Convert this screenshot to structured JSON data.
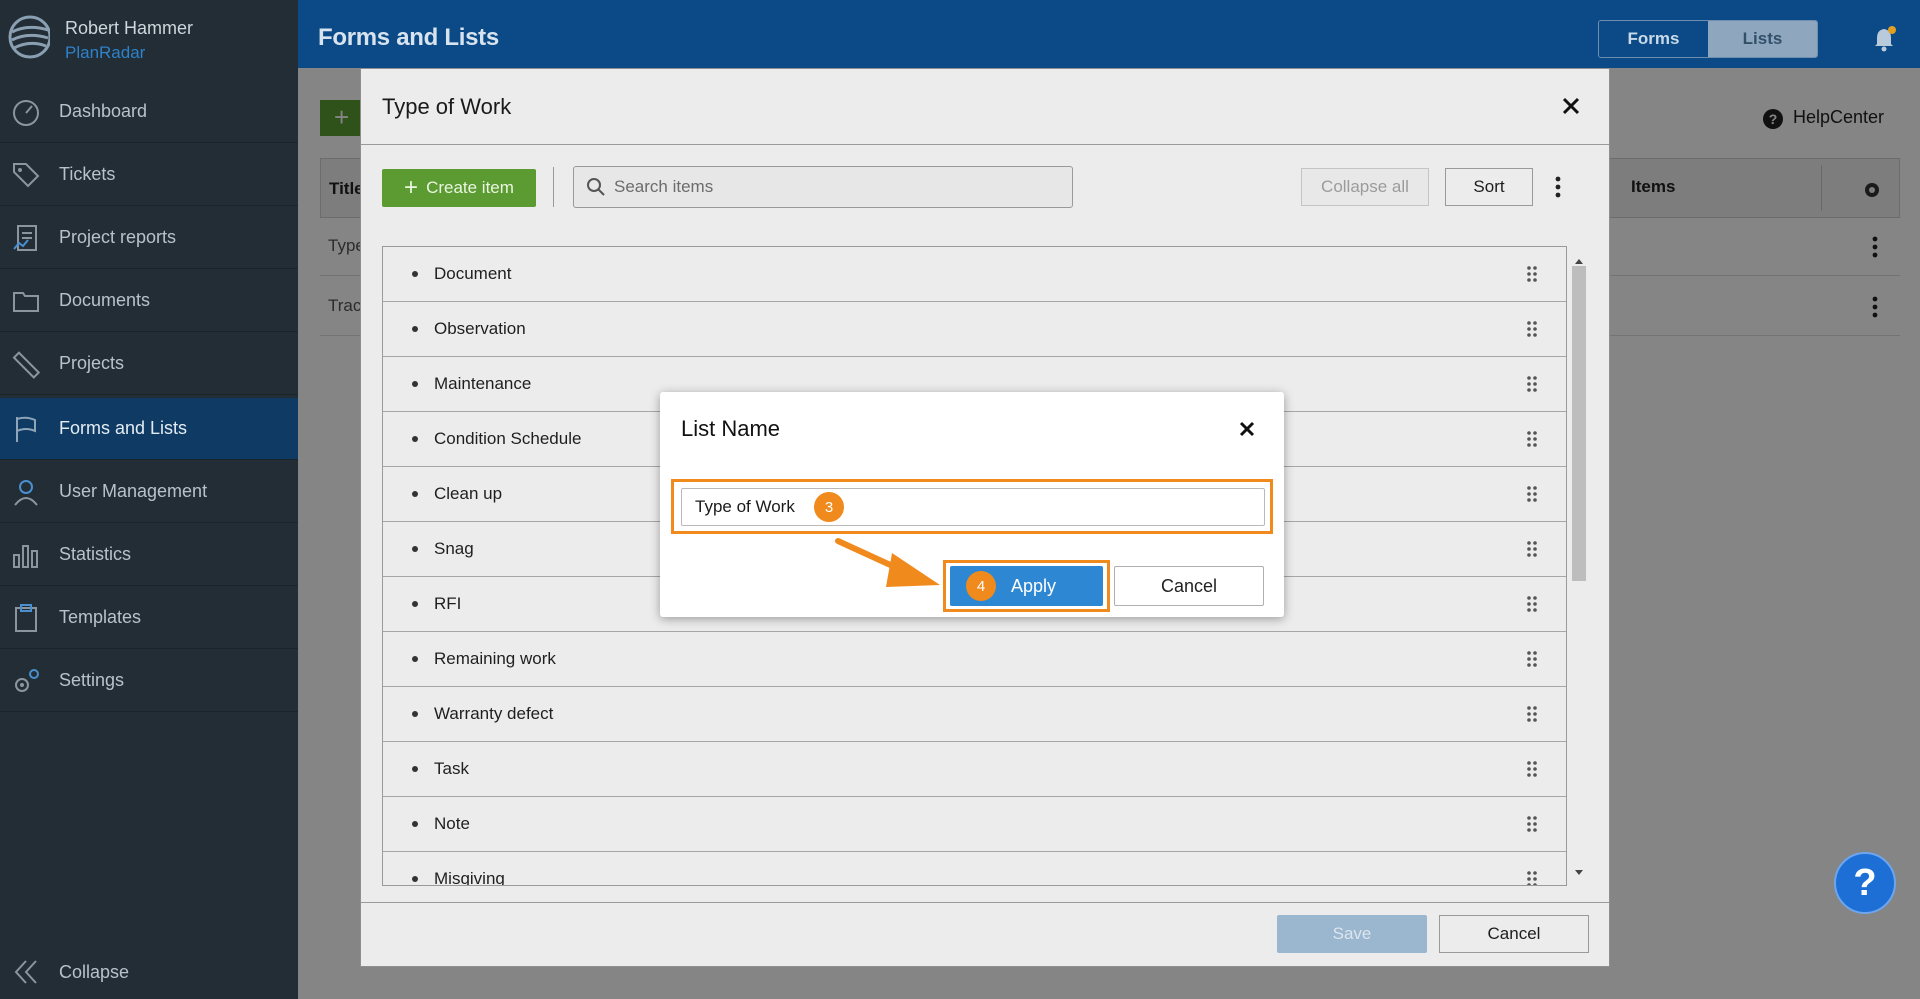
{
  "user": {
    "name": "Robert Hammer",
    "brand": "PlanRadar"
  },
  "sidebar": {
    "items": [
      {
        "label": "Dashboard",
        "icon": "gauge-icon"
      },
      {
        "label": "Tickets",
        "icon": "tag-icon"
      },
      {
        "label": "Project reports",
        "icon": "report-icon"
      },
      {
        "label": "Documents",
        "icon": "folder-icon"
      },
      {
        "label": "Projects",
        "icon": "ruler-icon"
      },
      {
        "label": "Forms and Lists",
        "icon": "flag-icon",
        "active": true
      },
      {
        "label": "User Management",
        "icon": "user-icon"
      },
      {
        "label": "Statistics",
        "icon": "bar-chart-icon"
      },
      {
        "label": "Templates",
        "icon": "clipboard-icon"
      },
      {
        "label": "Settings",
        "icon": "gear-icon"
      }
    ],
    "collapse_label": "Collapse"
  },
  "header": {
    "title": "Forms and Lists",
    "tabs": [
      {
        "label": "Forms",
        "active": true
      },
      {
        "label": "Lists",
        "active": false
      }
    ]
  },
  "background": {
    "helpcenter_label": "HelpCenter",
    "col_title": "Title",
    "col_items": "Items",
    "rows": [
      "Type",
      "Trac"
    ]
  },
  "modal": {
    "title": "Type of Work",
    "create_label": "Create item",
    "search_placeholder": "Search items",
    "collapse_all_label": "Collapse all",
    "sort_label": "Sort",
    "items": [
      "Document",
      "Observation",
      "Maintenance",
      "Condition Schedule",
      "Clean up",
      "Snag",
      "RFI",
      "Remaining work",
      "Warranty defect",
      "Task",
      "Note",
      "Misgiving"
    ],
    "save_label": "Save",
    "cancel_label": "Cancel"
  },
  "dialog": {
    "title": "List Name",
    "input_value": "Type of Work",
    "apply_label": "Apply",
    "cancel_label": "Cancel",
    "step_input": "3",
    "step_apply": "4"
  },
  "colors": {
    "accent": "#f08a1c",
    "primary": "#2e87d3",
    "sidebar": "#222d35",
    "topbar": "#0b4a86",
    "create": "#5b9b32"
  },
  "help_fab": "?"
}
